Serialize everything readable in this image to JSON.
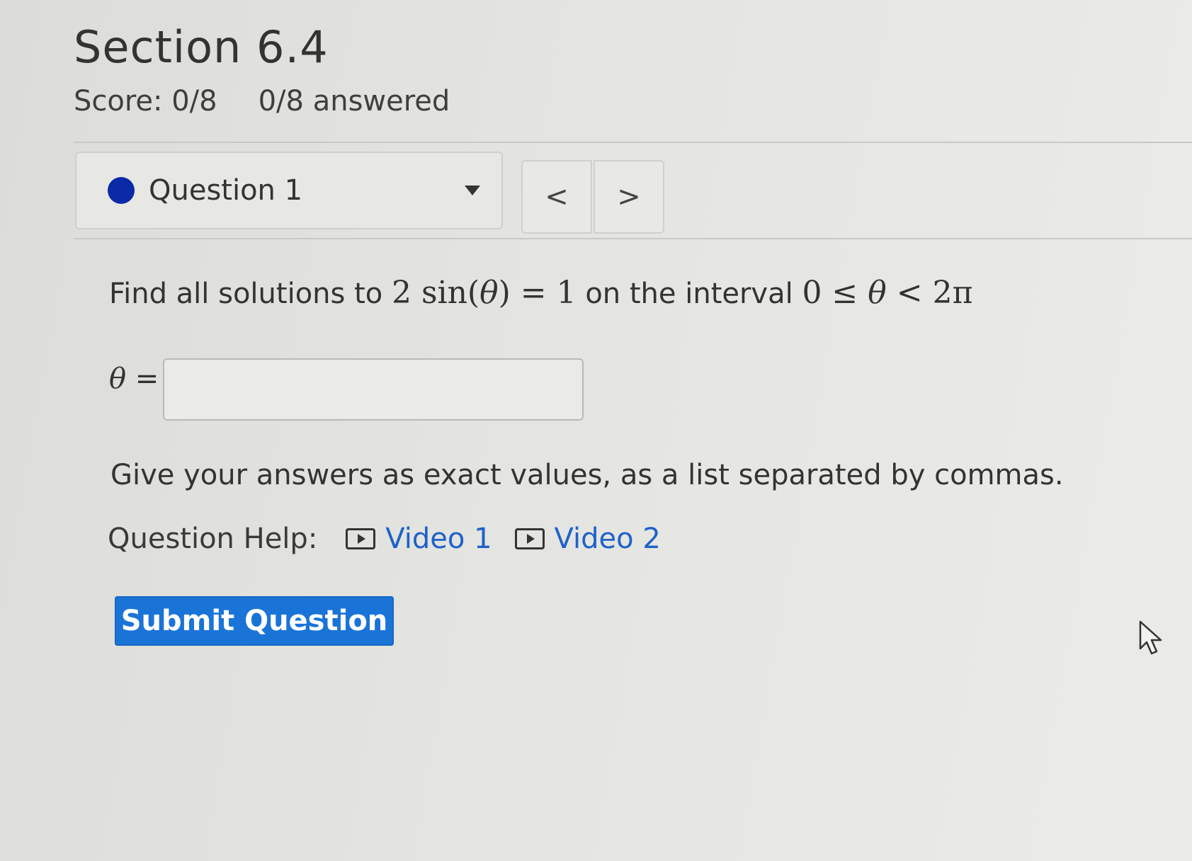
{
  "section": {
    "title": "Section 6.4",
    "score": "Score: 0/8",
    "answered": "0/8 answered"
  },
  "question_nav": {
    "selected_label": "Question 1",
    "prev_glyph": "<",
    "next_glyph": ">",
    "status_color": "#0a2aa8"
  },
  "question": {
    "prompt_prefix": "Find all solutions to ",
    "equation_coef": "2",
    "equation_fn": " sin(",
    "equation_var": "θ",
    "equation_close": ") = 1",
    "prompt_middle": " on the interval ",
    "interval_left": "0 ≤ ",
    "interval_var": "θ",
    "interval_right": " < 2π",
    "answer_label_var": "θ",
    "answer_label_eq": " =",
    "answer_value": "",
    "instructions": "Give your answers as exact values, as a list separated by commas."
  },
  "help": {
    "label": "Question Help:",
    "links": [
      {
        "label": "Video 1",
        "icon": "video-play-icon"
      },
      {
        "label": "Video 2",
        "icon": "video-play-icon"
      }
    ],
    "link_color": "#1e62c8"
  },
  "submit": {
    "label": "Submit Question",
    "color": "#1a74d8"
  }
}
